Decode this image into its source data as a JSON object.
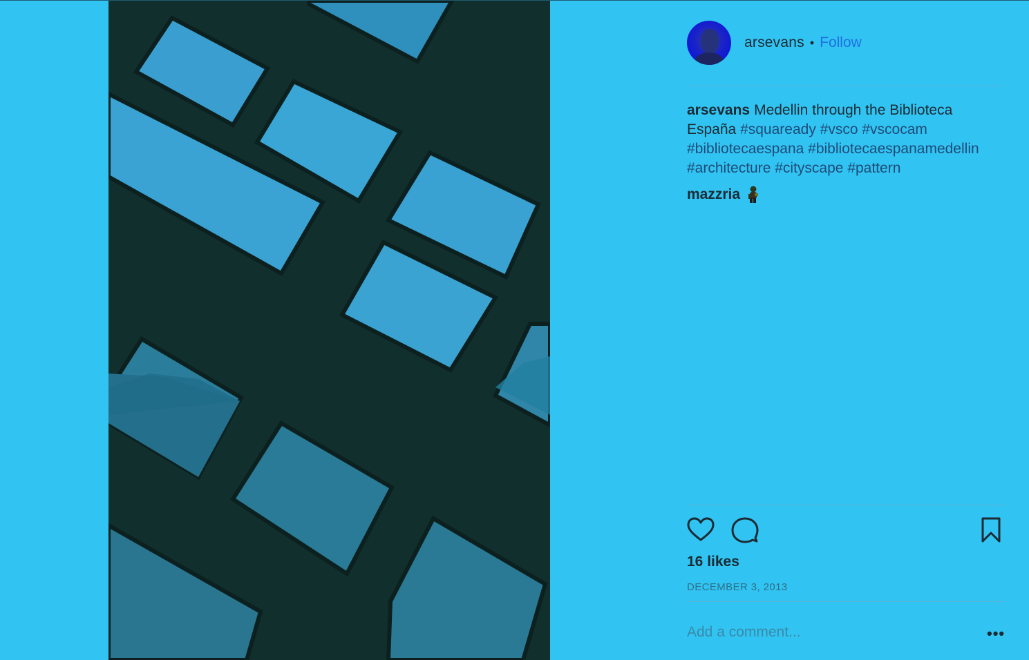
{
  "post": {
    "username": "arsevans",
    "separator": "•",
    "follow_label": "Follow",
    "caption": {
      "username": "arsevans",
      "text": "Medellin through the Biblioteca España",
      "hashtags": [
        "#squaready",
        "#vsco",
        "#vscocam",
        "#bibliotecaespana",
        "#bibliotecaespanamedellin",
        "#architecture",
        "#cityscape",
        "#pattern"
      ]
    },
    "comments": [
      {
        "username": "mazzria",
        "emoji": "man-emoji"
      }
    ],
    "likes_label": "16 likes",
    "date": "DECEMBER 3, 2013",
    "add_comment_placeholder": "Add a comment...",
    "more_label": "•••"
  },
  "icons": {
    "like": "heart-icon",
    "comment": "speech-bubble-icon",
    "save": "bookmark-icon",
    "more": "ellipsis-icon"
  },
  "colors": {
    "background": "#31c4f3",
    "follow_link": "#1f6fe0",
    "text": "#1b2a33",
    "date": "#2f6f88"
  }
}
